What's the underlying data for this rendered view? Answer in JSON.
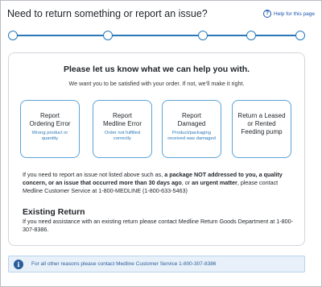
{
  "page": {
    "title": "Need to return something or report an issue?",
    "help_label": "Help for this page"
  },
  "stepper": {
    "steps": 5,
    "current": 1
  },
  "card": {
    "title": "Please let us know what we can help you with.",
    "subtitle": "We want you to be satisfied with your order. If not, we’ll make it right.",
    "options": [
      {
        "title_l1": "Report",
        "title_l2": "Ordering Error",
        "desc": "Wrong product or quantity"
      },
      {
        "title_l1": "Report",
        "title_l2": "Medline Error",
        "desc": "Order not fulfilled correctly"
      },
      {
        "title_l1": "Report",
        "title_l2": "Damaged",
        "desc": "Product/packaging received was damaged"
      },
      {
        "title_l1": "Return a Leased",
        "title_l2": "or Rented",
        "title_l3": "Feeding pump",
        "desc": ""
      }
    ],
    "note": {
      "p1": "If you need to report an issue not listed above such as, ",
      "b1": "a package NOT addressed to you, a quality concern, or an issue that occurred more than 30 days ago",
      "p2": ", or ",
      "b2": "an urgent matter",
      "p3": ", please contact Medline Customer Service at 1-800-MEDLINE (1-800-633-5463)"
    },
    "existing": {
      "title": "Existing Return",
      "text": "If you need assistance with an existing return please contact Medline Return Goods Department at 1-800-307-8386."
    }
  },
  "info": {
    "icon": "info-icon",
    "text": "For all other reasons please contact Medline Customer Service 1-800-307-8386"
  },
  "colors": {
    "accent": "#2a78b8",
    "link": "#1a56b0",
    "info_bg": "#e8f1f9"
  }
}
